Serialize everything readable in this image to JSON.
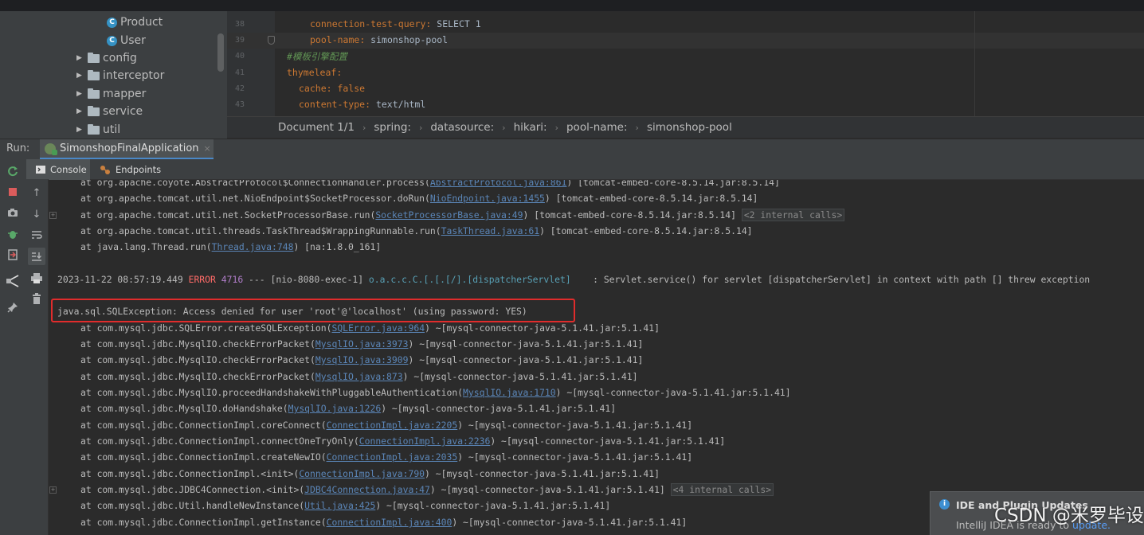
{
  "project_tree": {
    "items": [
      {
        "kind": "class",
        "label": "Product"
      },
      {
        "kind": "class",
        "label": "User"
      },
      {
        "kind": "folder",
        "label": "config"
      },
      {
        "kind": "folder",
        "label": "interceptor"
      },
      {
        "kind": "folder",
        "label": "mapper"
      },
      {
        "kind": "folder",
        "label": "service"
      },
      {
        "kind": "folder",
        "label": "util"
      }
    ]
  },
  "editor": {
    "lines": [
      {
        "num": "38",
        "key": "connection-test-query",
        "value": " SELECT 1"
      },
      {
        "num": "39",
        "key": "pool-name",
        "value": " simonshop-pool"
      },
      {
        "num": "40",
        "comment": "#模板引擎配置"
      },
      {
        "num": "41",
        "key": "thymeleaf",
        "value": ""
      },
      {
        "num": "42",
        "key": "cache",
        "value": " false"
      },
      {
        "num": "43",
        "key": "content-type",
        "value": " text/html"
      }
    ]
  },
  "breadcrumb": [
    "Document 1/1",
    "spring:",
    "datasource:",
    "hikari:",
    "pool-name:",
    "simonshop-pool"
  ],
  "run": {
    "label": "Run:",
    "config_name": "SimonshopFinalApplication",
    "close": "×"
  },
  "console_tabs": {
    "console": "Console",
    "endpoints": "Endpoints"
  },
  "console": {
    "top_frames": [
      {
        "prefix": "at org.apache.coyote.AbstractProtocol$ConnectionHandler.process(",
        "link": "AbstractProtocol.java:861",
        "suffix": ") [tomcat-embed-core-8.5.14.jar:8.5.14]"
      },
      {
        "prefix": "at org.apache.tomcat.util.net.NioEndpoint$SocketProcessor.doRun(",
        "link": "NioEndpoint.java:1455",
        "suffix": ") [tomcat-embed-core-8.5.14.jar:8.5.14]"
      },
      {
        "prefix": "at org.apache.tomcat.util.net.SocketProcessorBase.run(",
        "link": "SocketProcessorBase.java:49",
        "suffix": ") [tomcat-embed-core-8.5.14.jar:8.5.14] ",
        "internal": "<2 internal calls>"
      },
      {
        "prefix": "at org.apache.tomcat.util.threads.TaskThread$WrappingRunnable.run(",
        "link": "TaskThread.java:61",
        "suffix": ") [tomcat-embed-core-8.5.14.jar:8.5.14]"
      },
      {
        "prefix": "at java.lang.Thread.run(",
        "link": "Thread.java:748",
        "suffix": ") [na:1.8.0_161]"
      }
    ],
    "log": {
      "timestamp": "2023-11-22 08:57:19.449 ",
      "level": "ERROR",
      "pid": " 4716",
      "thread": " --- [nio-8080-exec-1] ",
      "logger": "o.a.c.c.C.[.[.[/].[dispatcherServlet]",
      "message": "    : Servlet.service() for servlet [dispatcherServlet] in context with path [] threw exception"
    },
    "exception": "java.sql.SQLException: Access denied for user 'root'@'localhost' (using password: YES)",
    "frames": [
      {
        "prefix": "at com.mysql.jdbc.SQLError.createSQLException(",
        "link": "SQLError.java:964",
        "suffix": ") ~[mysql-connector-java-5.1.41.jar:5.1.41]"
      },
      {
        "prefix": "at com.mysql.jdbc.MysqlIO.checkErrorPacket(",
        "link": "MysqlIO.java:3973",
        "suffix": ") ~[mysql-connector-java-5.1.41.jar:5.1.41]"
      },
      {
        "prefix": "at com.mysql.jdbc.MysqlIO.checkErrorPacket(",
        "link": "MysqlIO.java:3909",
        "suffix": ") ~[mysql-connector-java-5.1.41.jar:5.1.41]"
      },
      {
        "prefix": "at com.mysql.jdbc.MysqlIO.checkErrorPacket(",
        "link": "MysqlIO.java:873",
        "suffix": ") ~[mysql-connector-java-5.1.41.jar:5.1.41]"
      },
      {
        "prefix": "at com.mysql.jdbc.MysqlIO.proceedHandshakeWithPluggableAuthentication(",
        "link": "MysqlIO.java:1710",
        "suffix": ") ~[mysql-connector-java-5.1.41.jar:5.1.41]"
      },
      {
        "prefix": "at com.mysql.jdbc.MysqlIO.doHandshake(",
        "link": "MysqlIO.java:1226",
        "suffix": ") ~[mysql-connector-java-5.1.41.jar:5.1.41]"
      },
      {
        "prefix": "at com.mysql.jdbc.ConnectionImpl.coreConnect(",
        "link": "ConnectionImpl.java:2205",
        "suffix": ") ~[mysql-connector-java-5.1.41.jar:5.1.41]"
      },
      {
        "prefix": "at com.mysql.jdbc.ConnectionImpl.connectOneTryOnly(",
        "link": "ConnectionImpl.java:2236",
        "suffix": ") ~[mysql-connector-java-5.1.41.jar:5.1.41]"
      },
      {
        "prefix": "at com.mysql.jdbc.ConnectionImpl.createNewIO(",
        "link": "ConnectionImpl.java:2035",
        "suffix": ") ~[mysql-connector-java-5.1.41.jar:5.1.41]"
      },
      {
        "prefix": "at com.mysql.jdbc.ConnectionImpl.<init>(",
        "link": "ConnectionImpl.java:790",
        "suffix": ") ~[mysql-connector-java-5.1.41.jar:5.1.41]"
      },
      {
        "prefix": "at com.mysql.jdbc.JDBC4Connection.<init>(",
        "link": "JDBC4Connection.java:47",
        "suffix": ") ~[mysql-connector-java-5.1.41.jar:5.1.41] ",
        "internal": "<4 internal calls>"
      },
      {
        "prefix": "at com.mysql.jdbc.Util.handleNewInstance(",
        "link": "Util.java:425",
        "suffix": ") ~[mysql-connector-java-5.1.41.jar:5.1.41]"
      },
      {
        "prefix": "at com.mysql.jdbc.ConnectionImpl.getInstance(",
        "link": "ConnectionImpl.java:400",
        "suffix": ") ~[mysql-connector-java-5.1.41.jar:5.1.41]"
      }
    ]
  },
  "notification": {
    "title": "IDE and Plugin Updates",
    "body": "IntelliJ IDEA is ready to ",
    "link": "update."
  },
  "watermark": "CSDN @米罗毕设",
  "colors": {
    "error": "#ff6b68",
    "link": "#5b86b8",
    "highlight_box": "#e02c2c",
    "accent": "#4a88c7"
  }
}
